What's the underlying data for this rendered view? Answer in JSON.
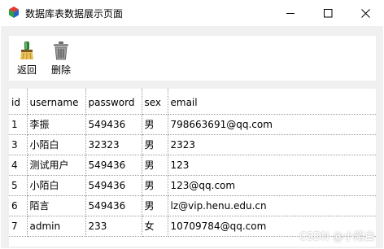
{
  "window": {
    "title": "数据库表数据展示页面",
    "controls": {
      "minimize": "—",
      "maximize": "☐",
      "close": "✕"
    }
  },
  "toolbar": {
    "back_label": "返回",
    "back_icon": "broom-icon",
    "delete_label": "删除",
    "delete_icon": "trash-can-icon"
  },
  "table": {
    "columns": [
      "id",
      "username",
      "password",
      "sex",
      "email"
    ],
    "rows": [
      [
        "1",
        "李振",
        "549436",
        "男",
        "798663691@qq.com"
      ],
      [
        "3",
        "小陌白",
        "32323",
        "男",
        "2323"
      ],
      [
        "4",
        "测试用户",
        "549436",
        "男",
        "123"
      ],
      [
        "5",
        "小陌白",
        "549436",
        "男",
        "123@qq.com"
      ],
      [
        "6",
        "陌言",
        "549436",
        "男",
        "lz@vip.henu.edu.cn"
      ],
      [
        "7",
        "admin",
        "233",
        "女",
        "10709784@qq.com"
      ]
    ]
  },
  "watermark": "CSDN @小陌白",
  "colors": {
    "client_bg": "#f0f0f0",
    "panel_bg": "#ffffff",
    "grid_line": "#9a9a9a"
  }
}
